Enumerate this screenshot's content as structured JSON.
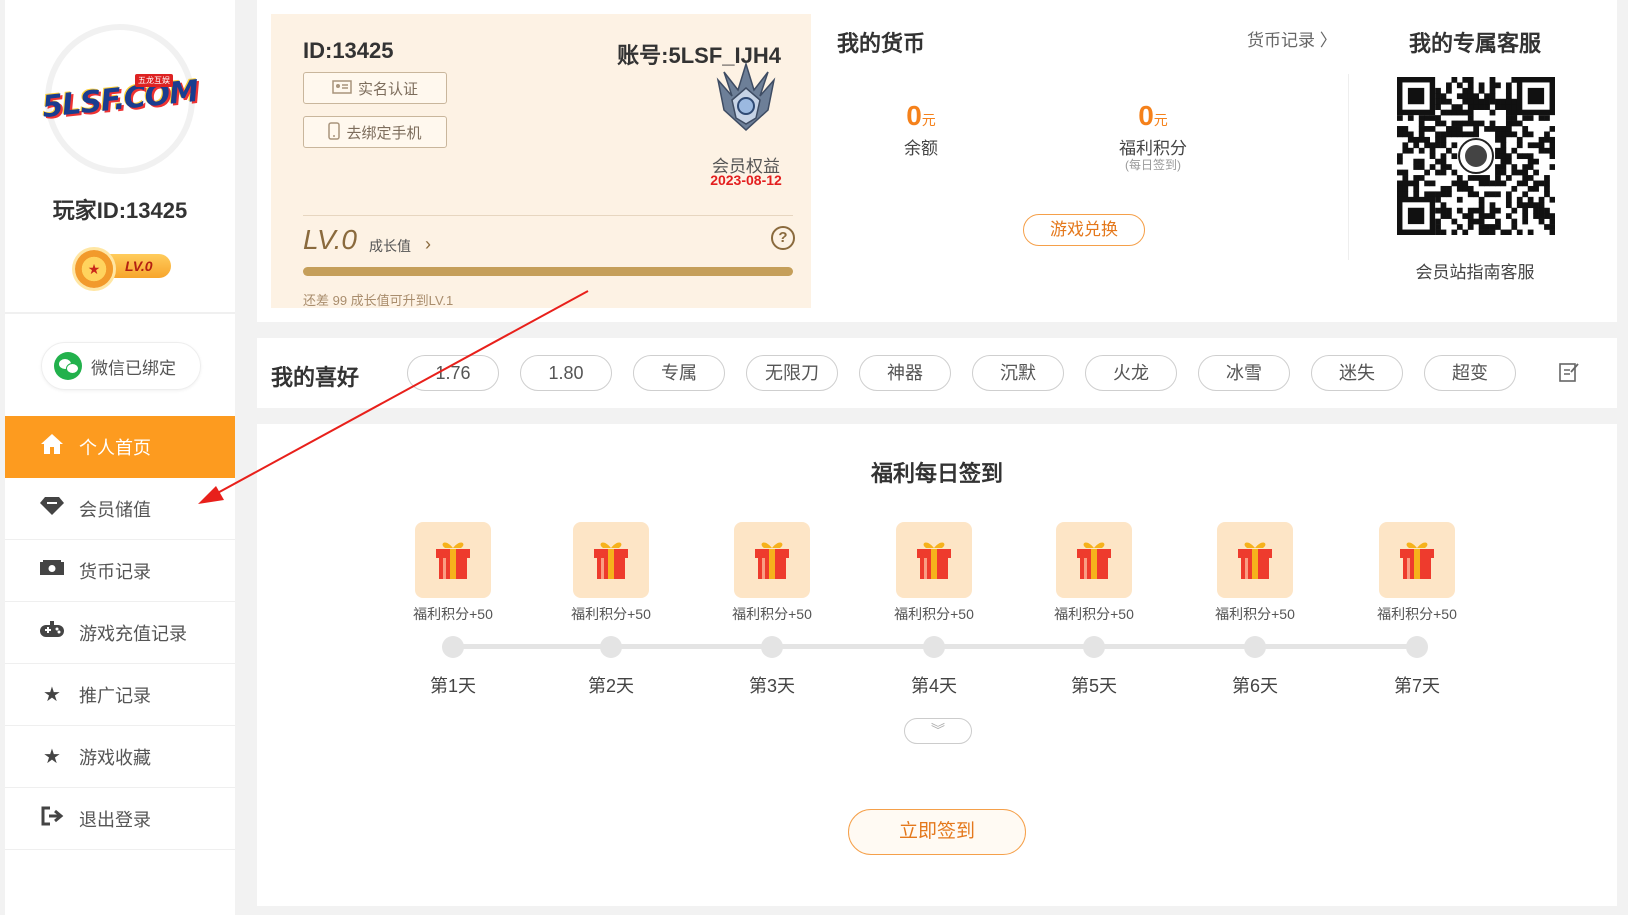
{
  "sidebar": {
    "logo_text": "5LSF.COM",
    "logo_sub": "五龙互娱",
    "player_id": "玩家ID:13425",
    "level": "LV.0",
    "wechat": "微信已绑定",
    "menu": [
      {
        "label": "个人首页",
        "icon": "home-icon"
      },
      {
        "label": "会员储值",
        "icon": "diamond-icon"
      },
      {
        "label": "货币记录",
        "icon": "money-icon"
      },
      {
        "label": "游戏充值记录",
        "icon": "gamepad-icon"
      },
      {
        "label": "推广记录",
        "icon": "star-icon"
      },
      {
        "label": "游戏收藏",
        "icon": "star-icon"
      },
      {
        "label": "退出登录",
        "icon": "logout-icon"
      }
    ]
  },
  "member": {
    "id": "ID:13425",
    "account": "账号:5LSF_IJH4",
    "realname_btn": "实名认证",
    "phone_btn": "去绑定手机",
    "benefit": "会员权益",
    "date": "2023-08-12",
    "level": "LV.0",
    "growth_label": "成长值",
    "help": "?",
    "progress_percent": 0,
    "hint": "还差 99 成长值可升到LV.1"
  },
  "currency": {
    "title": "我的货币",
    "record_link": "货币记录",
    "balance_value": "0",
    "unit": "元",
    "balance_label": "余额",
    "points_value": "0",
    "points_label": "福利积分",
    "points_sub": "(每日签到)",
    "exchange_btn": "游戏兑换"
  },
  "service": {
    "title": "我的专属客服",
    "label": "会员站指南客服"
  },
  "hobby": {
    "title": "我的喜好",
    "tags": [
      "1.76",
      "1.80",
      "专属",
      "无限刀",
      "神器",
      "沉默",
      "火龙",
      "冰雪",
      "迷失",
      "超变"
    ]
  },
  "signin": {
    "title": "福利每日签到",
    "days": [
      {
        "reward": "福利积分+50",
        "label": "第1天"
      },
      {
        "reward": "福利积分+50",
        "label": "第2天"
      },
      {
        "reward": "福利积分+50",
        "label": "第3天"
      },
      {
        "reward": "福利积分+50",
        "label": "第4天"
      },
      {
        "reward": "福利积分+50",
        "label": "第5天"
      },
      {
        "reward": "福利积分+50",
        "label": "第6天"
      },
      {
        "reward": "福利积分+50",
        "label": "第7天"
      }
    ],
    "button": "立即签到"
  },
  "colors": {
    "accent": "#fd9b1f",
    "currency": "#f5811b",
    "date": "#e31e1e",
    "annotation": "#e8201b"
  }
}
